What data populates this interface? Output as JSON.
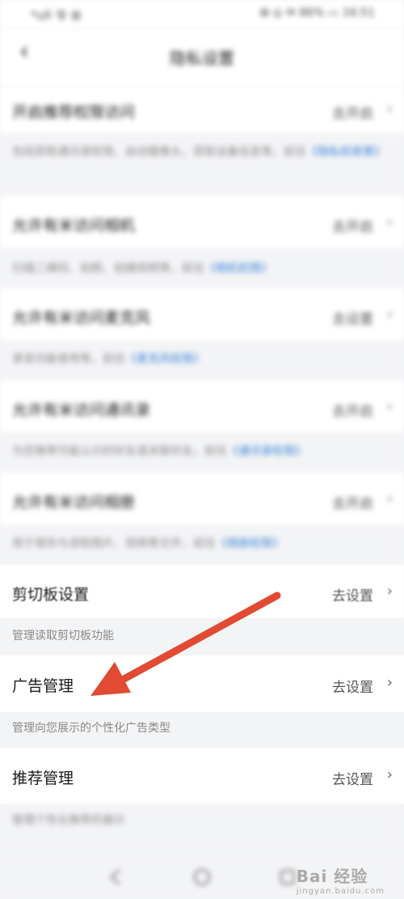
{
  "status_bar": {
    "signal": "*ull 令 ⊞",
    "right": "⊞ ◎ ✉ 86% ▭ 16:51"
  },
  "nav": {
    "back": "‹",
    "title": "隐私设置"
  },
  "blurred_rows": [
    {
      "label": "开启推荐权限访问",
      "action": "去开启",
      "desc": "包括获取通讯录权限、启动摄像头，获取设备信息等，前往",
      "link": "《隐私权政策》"
    },
    {
      "label": "允许有米访问相机",
      "action": "去开启",
      "desc": "扫描二维码、拍照、拍摄视频等，前往",
      "link": "《相机权限》"
    },
    {
      "label": "允许有米访问麦克风",
      "action": "去设置",
      "desc": "录音功能使用等，前往",
      "link": "《麦克风权限》"
    },
    {
      "label": "允许有米访问通讯录",
      "action": "去开启",
      "desc": "为您推荐可能认识的好友或关联好友，前往",
      "link": "《通讯录权限》"
    },
    {
      "label": "允许有米访问相册",
      "action": "去开启",
      "desc": "用于保存与读取图片、视频等文件，前往",
      "link": "《相册权限》"
    }
  ],
  "rows": {
    "clipboard": {
      "label": "剪切板设置",
      "action": "去设置",
      "desc": "管理读取剪切板功能"
    },
    "ads": {
      "label": "广告管理",
      "action": "去设置",
      "desc": "管理向您展示的个性化广告类型"
    },
    "recommend": {
      "label": "推荐管理",
      "action": "去设置",
      "desc": "管理个性化推荐的展示"
    }
  },
  "chevron": "›",
  "watermark": {
    "brand": "Bai 经验",
    "url": "jingyan.baidu.com"
  },
  "colors": {
    "link": "#3b82d6",
    "arrow": "#e24a33",
    "background": "#f3f4f6"
  }
}
